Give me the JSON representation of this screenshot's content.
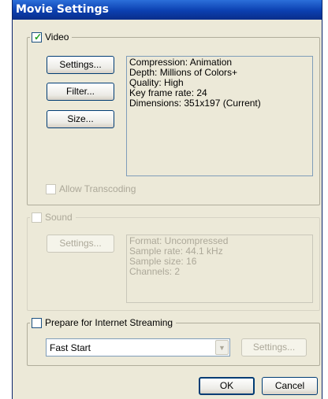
{
  "window": {
    "title": "Movie Settings"
  },
  "video": {
    "label": "Video",
    "checked": true,
    "buttons": {
      "settings": "Settings...",
      "filter": "Filter...",
      "size": "Size..."
    },
    "info": [
      "Compression: Animation",
      "Depth: Millions of Colors+",
      "Quality: High",
      "Key frame rate: 24",
      "Dimensions: 351x197 (Current)"
    ],
    "allow_transcoding": {
      "label": "Allow Transcoding",
      "checked": false,
      "enabled": false
    }
  },
  "sound": {
    "label": "Sound",
    "checked": false,
    "enabled": false,
    "buttons": {
      "settings": "Settings..."
    },
    "info": [
      "Format: Uncompressed",
      "Sample rate: 44.1 kHz",
      "Sample size: 16",
      "Channels: 2"
    ]
  },
  "streaming": {
    "label": "Prepare for Internet Streaming",
    "checked": false,
    "select_value": "Fast Start",
    "settings_label": "Settings..."
  },
  "footer": {
    "ok": "OK",
    "cancel": "Cancel"
  }
}
